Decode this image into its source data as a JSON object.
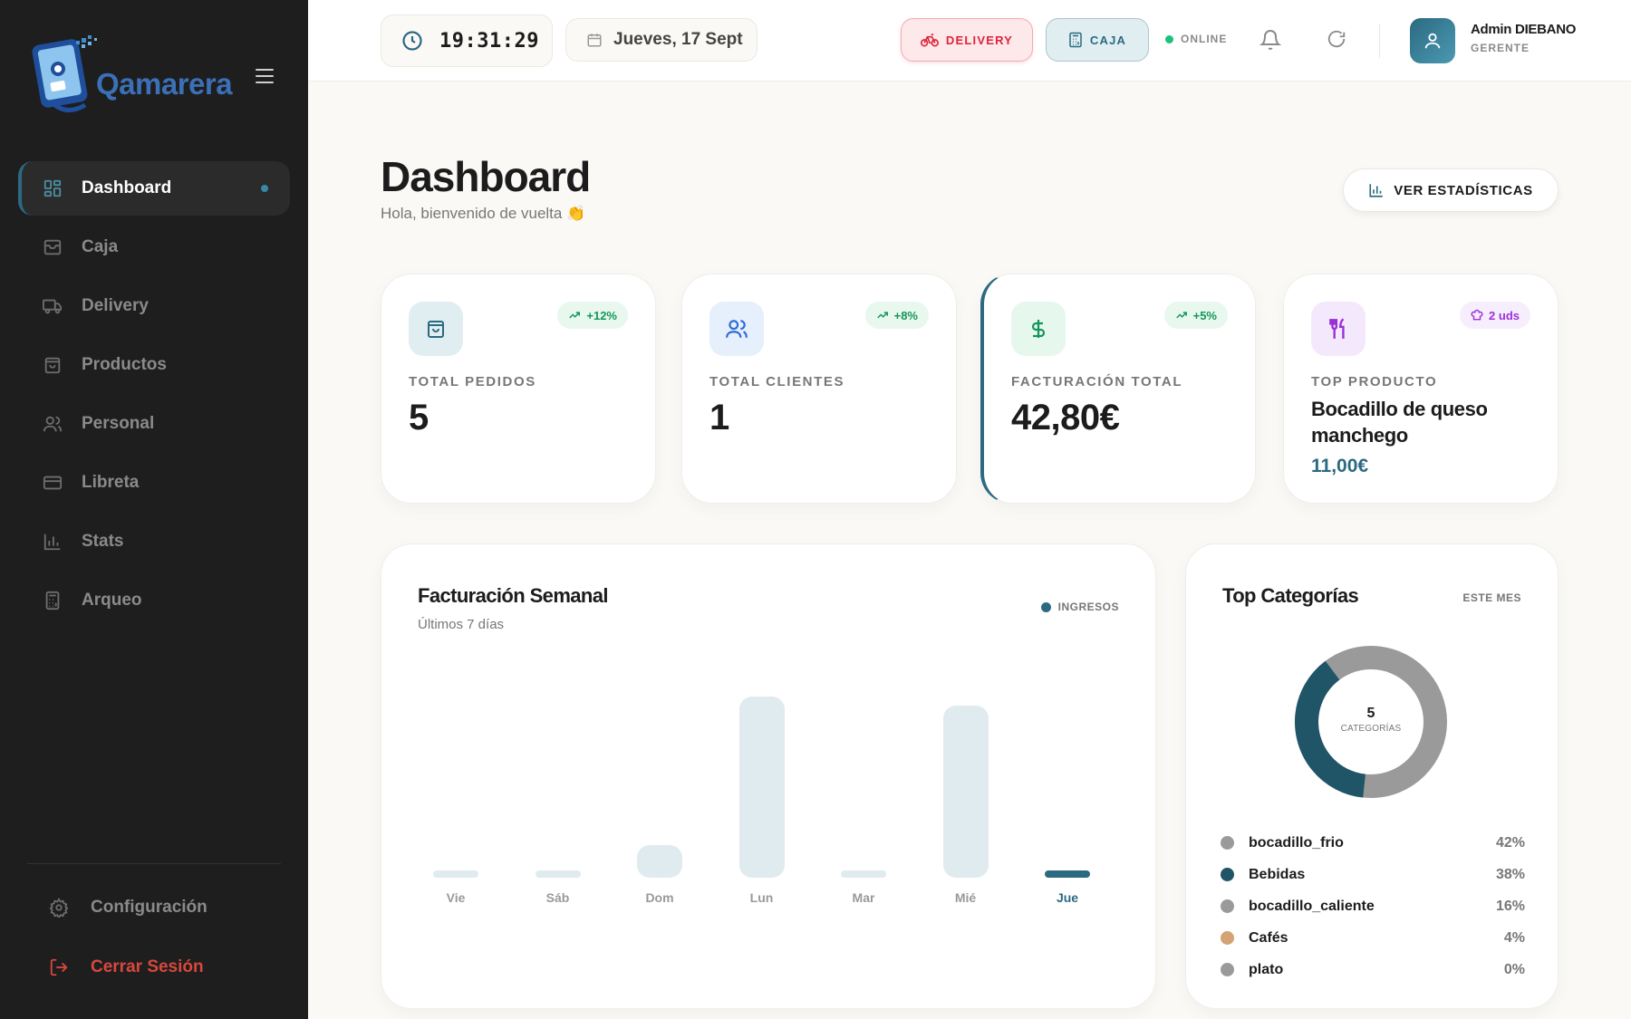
{
  "app": {
    "name": "Qamarera"
  },
  "sidebar": {
    "items": [
      {
        "label": "Dashboard",
        "icon": "dashboard-grid-icon",
        "active": true
      },
      {
        "label": "Caja",
        "icon": "inbox-tray-icon"
      },
      {
        "label": "Delivery",
        "icon": "truck-icon"
      },
      {
        "label": "Productos",
        "icon": "shopping-bag-icon"
      },
      {
        "label": "Personal",
        "icon": "users-icon"
      },
      {
        "label": "Libreta",
        "icon": "credit-card-icon"
      },
      {
        "label": "Stats",
        "icon": "bar-chart-icon"
      },
      {
        "label": "Arqueo",
        "icon": "calculator-icon"
      }
    ],
    "settings_label": "Configuración",
    "logout_label": "Cerrar Sesión"
  },
  "topbar": {
    "time": "19:31:29",
    "date": "Jueves, 17 Sept",
    "delivery_label": "DELIVERY",
    "caja_label": "CAJA",
    "status": "ONLINE",
    "user": {
      "name": "Admin DIEBANO",
      "role": "GERENTE"
    }
  },
  "colors": {
    "accent": "#2b6a80",
    "delivery": "#e0243a",
    "online": "#1cc27a",
    "sidebar_bg": "#1e1e1e"
  },
  "header": {
    "title": "Dashboard",
    "subtitle": "Hola, bienvenido de vuelta 👏",
    "stats_button": "VER ESTADÍSTICAS"
  },
  "cards": [
    {
      "label": "TOTAL PEDIDOS",
      "value": "5",
      "trend": "+12%",
      "icon": "shopping-bag-icon"
    },
    {
      "label": "TOTAL CLIENTES",
      "value": "1",
      "trend": "+8%",
      "icon": "users-icon"
    },
    {
      "label": "FACTURACIÓN TOTAL",
      "value": "42,80€",
      "trend": "+5%",
      "icon": "dollar-icon"
    },
    {
      "label": "TOP PRODUCTO",
      "product": "Bocadillo de queso manchego",
      "price": "11,00€",
      "badge": "2 uds",
      "icon": "utensils-icon"
    }
  ],
  "weekly": {
    "title": "Facturación Semanal",
    "subtitle": "Últimos 7 días",
    "legend": "INGRESOS"
  },
  "chart_data": {
    "type": "bar",
    "categories": [
      "Vie",
      "Sáb",
      "Dom",
      "Lun",
      "Mar",
      "Mié",
      "Jue"
    ],
    "values": [
      0,
      0,
      3.5,
      19.6,
      0,
      18.6,
      0
    ],
    "current_index": 6
  },
  "categories_panel": {
    "title": "Top Categorías",
    "period": "ESTE MES",
    "center_value": "5",
    "center_label": "CATEGORÍAS",
    "items": [
      {
        "name": "bocadillo_frio",
        "pct": "42%",
        "color": "#9a9a9a"
      },
      {
        "name": "Bebidas",
        "pct": "38%",
        "color": "#1f5566"
      },
      {
        "name": "bocadillo_caliente",
        "pct": "16%",
        "color": "#9a9a9a"
      },
      {
        "name": "Cafés",
        "pct": "4%",
        "color": "#d4a373"
      },
      {
        "name": "plato",
        "pct": "0%",
        "color": "#9a9a9a"
      }
    ]
  }
}
